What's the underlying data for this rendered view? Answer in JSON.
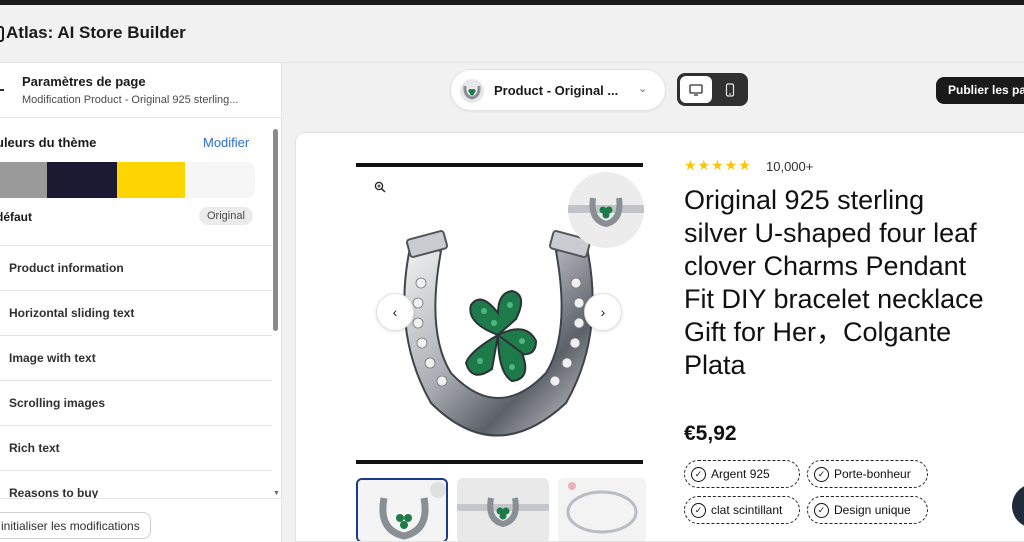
{
  "app": {
    "title": "Atlas: AI Store Builder"
  },
  "sidebar": {
    "title": "Paramètres de page",
    "subtitle": "Modification Product - Original 925 sterling...",
    "theme": {
      "label": "uleurs du thème",
      "edit_label": "Modifier",
      "swatches": [
        "#9a9a9a",
        "#1c1a33",
        "#ffd500",
        "#f6f6f6"
      ]
    },
    "default_label": "défaut",
    "default_badge": "Original",
    "sections": [
      {
        "label": "Product information"
      },
      {
        "label": "Horizontal sliding text"
      },
      {
        "label": "Image with text"
      },
      {
        "label": "Scrolling images"
      },
      {
        "label": "Rich text"
      },
      {
        "label": "Reasons to buy"
      }
    ],
    "reset_label": "initialiser les modifications"
  },
  "toolbar": {
    "template_label": "Product - Original ...",
    "device_active": "desktop",
    "publish_label": "Publier les pa"
  },
  "product": {
    "rating": 5,
    "stars": "★★★★★",
    "reviews": "10,000+",
    "title": "Original 925 sterling silver U-shaped four leaf clover Charms Pendant Fit DIY bracelet necklace Gift for Her，Colgante Plata",
    "price": "€5,92",
    "badges": [
      "Argent 925",
      "Porte-bonheur",
      "clat scintillant",
      "Design unique"
    ]
  },
  "colors": {
    "accent": "#2c6ecb",
    "star": "#ffc400",
    "clover_green": "#1f7a4a"
  }
}
